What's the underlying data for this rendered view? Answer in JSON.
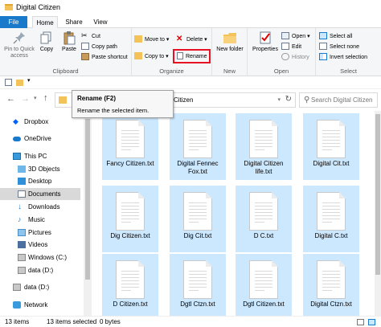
{
  "window": {
    "title": "Digital Citizen"
  },
  "tabs": {
    "file": "File",
    "home": "Home",
    "share": "Share",
    "view": "View"
  },
  "ribbon": {
    "clipboard": {
      "group_label": "Clipboard",
      "pin_label": "Pin to Quick access",
      "copy_label": "Copy",
      "paste_label": "Paste",
      "cut_label": "Cut",
      "copy_path_label": "Copy path",
      "paste_shortcut_label": "Paste shortcut"
    },
    "organize": {
      "group_label": "Organize",
      "move_to_label": "Move to",
      "copy_to_label": "Copy to",
      "delete_label": "Delete",
      "rename_label": "Rename"
    },
    "new": {
      "group_label": "New",
      "new_folder_label": "New folder"
    },
    "open": {
      "group_label": "Open",
      "properties_label": "Properties",
      "open_label": "Open",
      "edit_label": "Edit",
      "history_label": "History"
    },
    "select": {
      "group_label": "Select",
      "select_all_label": "Select all",
      "select_none_label": "Select none",
      "invert_label": "Invert selection"
    }
  },
  "address": {
    "path_tail": "Citizen",
    "search_placeholder": "Search Digital Citizen"
  },
  "tooltip": {
    "title": "Rename (F2)",
    "body": "Rename the selected item."
  },
  "nav": {
    "dropbox": "Dropbox",
    "onedrive": "OneDrive",
    "this_pc": "This PC",
    "objects_3d": "3D Objects",
    "desktop": "Desktop",
    "documents": "Documents",
    "downloads": "Downloads",
    "music": "Music",
    "pictures": "Pictures",
    "videos": "Videos",
    "windows_c": "Windows (C:)",
    "data_d": "data (D:)",
    "data_d2": "data (D:)",
    "network": "Network"
  },
  "files": [
    {
      "name": "Fancy Citizen.txt"
    },
    {
      "name": "Digital Fennec Fox.txt"
    },
    {
      "name": "Digital Citizen life.txt"
    },
    {
      "name": "Digital Cit.txt"
    },
    {
      "name": "Dig Citizen.txt"
    },
    {
      "name": "Dig Cit.txt"
    },
    {
      "name": "D C.txt"
    },
    {
      "name": "Digital C.txt"
    },
    {
      "name": "D Citizen.txt"
    },
    {
      "name": "Dgtl Ctzn.txt"
    },
    {
      "name": "Dgtl Citizen.txt"
    },
    {
      "name": "Digital Ctzn.txt"
    }
  ],
  "status": {
    "items": "13 items",
    "selected": "13 items selected",
    "size": "0 bytes"
  },
  "colors": {
    "accent": "#1979ca",
    "selection": "#cce8ff",
    "highlight_box": "#e81123"
  }
}
